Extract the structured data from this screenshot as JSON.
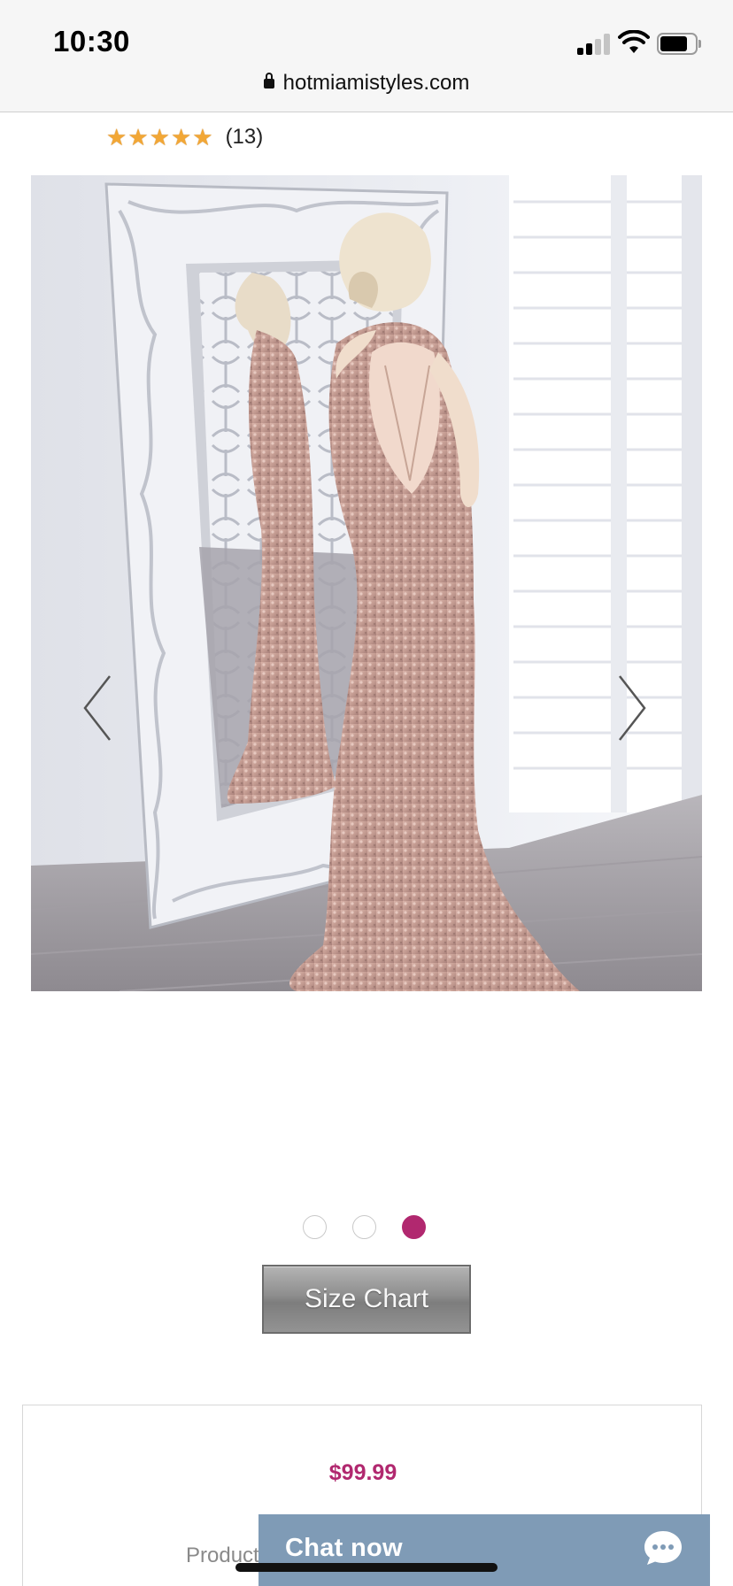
{
  "status_bar": {
    "time": "10:30"
  },
  "browser": {
    "url": "hotmiamistyles.com"
  },
  "product": {
    "rating_stars": 5,
    "review_count": "(13)",
    "image_alt": "",
    "price": "$99.99",
    "product_label": "Product",
    "size_chart_label": "Size Chart"
  },
  "carousel": {
    "slides": 3,
    "active_index": 2
  },
  "chat": {
    "label": "Chat now"
  },
  "colors": {
    "accent": "#b1286f",
    "chat_bg": "#7f9bb6",
    "star": "#f2a736"
  },
  "icons": {
    "prev": "chevron-left-icon",
    "next": "chevron-right-icon",
    "lock": "lock-icon",
    "chat": "chat-bubble-icon"
  }
}
